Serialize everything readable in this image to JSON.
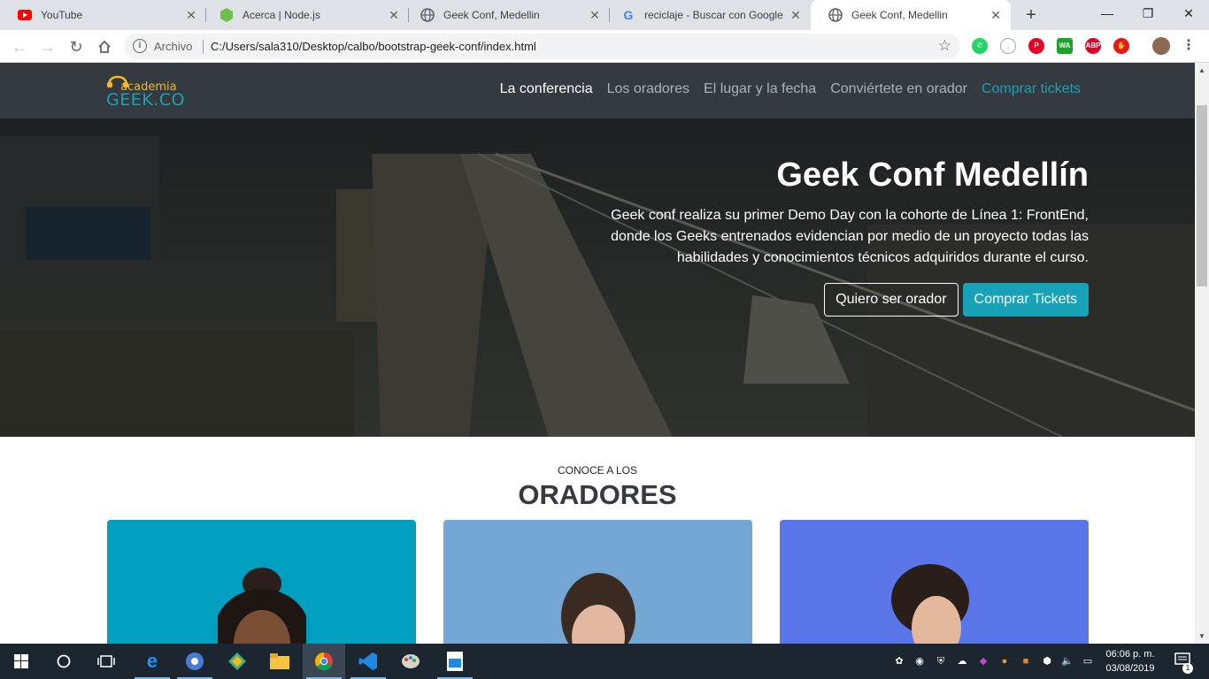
{
  "browser": {
    "tabs": [
      {
        "title": "YouTube",
        "icon": "youtube-icon",
        "color": "#ff0000"
      },
      {
        "title": "Acerca | Node.js",
        "icon": "nodejs-icon",
        "color": "#6cc24a"
      },
      {
        "title": "Geek Conf, Medellin",
        "icon": "globe-icon",
        "color": "#5f6368"
      },
      {
        "title": "reciclaje - Buscar con Google",
        "icon": "google-icon",
        "color": "#4285f4"
      },
      {
        "title": "Geek Conf, Medellin",
        "icon": "globe-icon",
        "color": "#5f6368",
        "active": true
      }
    ],
    "new_tab": "+",
    "window_controls": {
      "minimize": "—",
      "maximize": "❐",
      "close": "✕"
    },
    "omnibox": {
      "security_label": "Archivo",
      "url": "C:/Users/sala310/Desktop/calbo/bootstrap-geek-conf/index.html"
    },
    "extensions": [
      "whatsapp-icon",
      "download-icon",
      "pinterest-icon",
      "wa-icon",
      "adblock-icon",
      "red-extension-icon"
    ],
    "ext_labels": {
      "wa": "WA",
      "abp": "ABP"
    }
  },
  "site": {
    "logo": {
      "small": "academia",
      "big": "GEEK.CO"
    },
    "nav": {
      "links": [
        "La conferencia",
        "Los oradores",
        "El lugar y la fecha",
        "Conviértete en orador"
      ],
      "cta": "Comprar tickets"
    },
    "hero": {
      "title": "Geek Conf Medellín",
      "text": "Geek conf realiza su primer Demo Day con la cohorte de Línea 1: FrontEnd, donde los Geeks entrenados evidencian por medio de un proyecto todas las habilidades y conocimientos técnicos adquiridos durante el curso.",
      "btn_speaker": "Quiero ser orador",
      "btn_tickets": "Comprar Tickets"
    },
    "speakers": {
      "kicker": "CONOCE A LOS",
      "heading": "ORADORES",
      "cards": [
        {
          "bg": "#009fc0"
        },
        {
          "bg": "#74a7d4"
        },
        {
          "bg": "#5b76e8"
        }
      ]
    }
  },
  "taskbar": {
    "time": "06:06 p. m.",
    "date": "03/08/2019",
    "notification_count": "1"
  }
}
